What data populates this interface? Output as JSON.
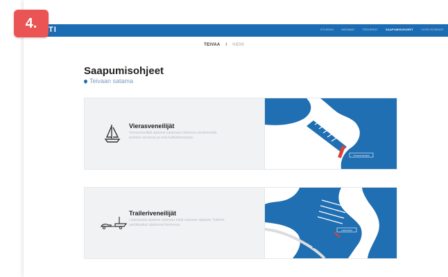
{
  "badge": {
    "label": "4."
  },
  "header": {
    "logo": "TI",
    "nav": [
      {
        "label": "Etusivu"
      },
      {
        "label": "Satamat"
      },
      {
        "label": "Teeveriit"
      },
      {
        "label": "Saapumisohjeet"
      },
      {
        "label": "Yhteystiedot"
      }
    ],
    "active_index": 3
  },
  "breadcrumb": {
    "active": "TEIVAA",
    "separator": "/",
    "other": "NIEMI"
  },
  "page": {
    "title": "Saapumisohjeet",
    "location": "Teivaan satama"
  },
  "cards": [
    {
      "icon": "sailboat-icon",
      "title": "Vierasveneilijät",
      "text": "Vierasveneilijät ajatuvat satamaan tulleessa vieraimmalla puolella rannassa ja ovat kyllästiinsaatoja.",
      "map_label": "Vierasvenepaikat"
    },
    {
      "icon": "trailer-boat-icon",
      "title": "Traileriveneilijät",
      "text": "Laskuluiska sijaitsee sataman etelä sataman sijaitsee Trailerin parkkipaikat sijaitsevat hiemessa.",
      "map_label": "Laskuluiska"
    }
  ],
  "colors": {
    "accent": "#1b6cb3",
    "badge": "#ea5455",
    "highlight": "#e0403a"
  }
}
